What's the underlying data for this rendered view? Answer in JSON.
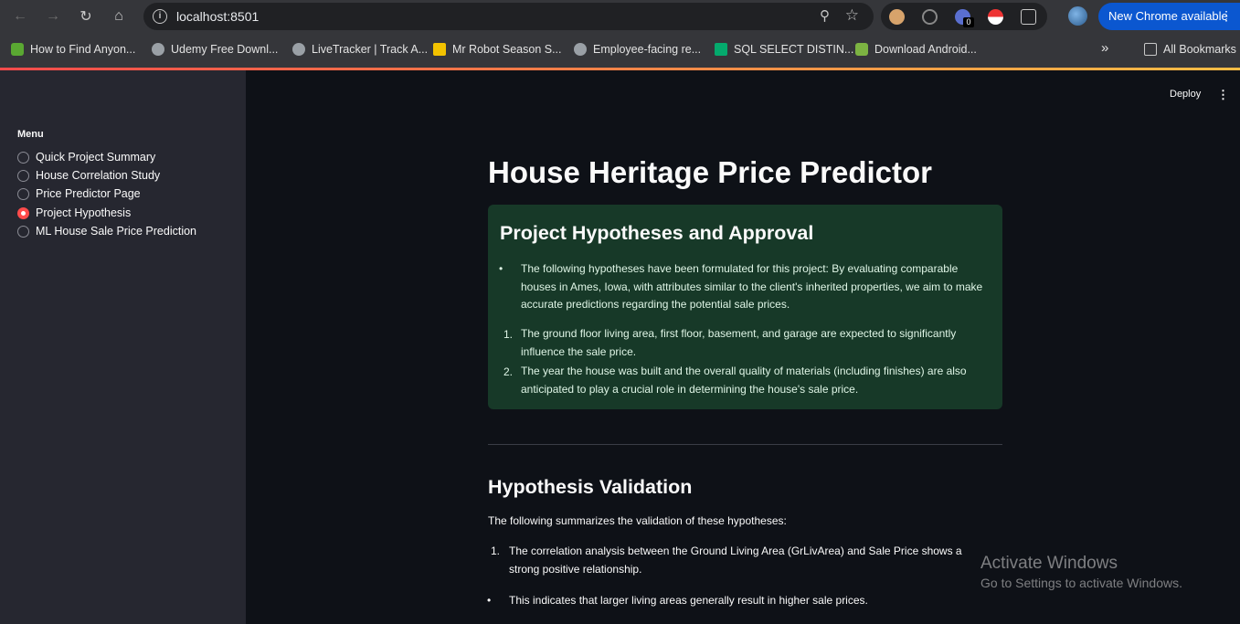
{
  "browser": {
    "url": "localhost:8501",
    "update_button": "New Chrome available",
    "extension_badge": "0",
    "bookmarks": [
      "How to Find Anyon...",
      "Udemy Free Downl...",
      "LiveTracker | Track A...",
      "Mr Robot Season S...",
      "Employee-facing re...",
      "SQL SELECT DISTIN...",
      "Download Android..."
    ],
    "bookmarks_overflow": "»",
    "all_bookmarks": "All Bookmarks"
  },
  "sidebar": {
    "menu_label": "Menu",
    "items": [
      {
        "label": "Quick Project Summary",
        "selected": false
      },
      {
        "label": "House Correlation Study",
        "selected": false
      },
      {
        "label": "Price Predictor Page",
        "selected": false
      },
      {
        "label": "Project Hypothesis",
        "selected": true
      },
      {
        "label": "ML House Sale Price Prediction",
        "selected": false
      }
    ]
  },
  "header": {
    "deploy_label": "Deploy"
  },
  "main": {
    "title": "House Heritage Price Predictor",
    "success_box": {
      "heading": "Project Hypotheses and Approval",
      "bullet": "The following hypotheses have been formulated for this project: By evaluating comparable houses in Ames, Iowa, with attributes similar to the client's inherited properties, we aim to make accurate predictions regarding the potential sale prices.",
      "numbered": [
        "The ground floor living area, first floor, basement, and garage are expected to significantly influence the sale price.",
        "The year the house was built and the overall quality of materials (including finishes) are also anticipated to play a crucial role in determining the house's sale price."
      ]
    },
    "validation_heading": "Hypothesis Validation",
    "validation_intro": "The following summarizes the validation of these hypotheses:",
    "validation_item_1": "The correlation analysis between the Ground Living Area (GrLivArea) and Sale Price shows a strong positive relationship.",
    "validation_bullet": "This indicates that larger living areas generally result in higher sale prices."
  },
  "watermark": {
    "line1": "Activate Windows",
    "line2": "Go to Settings to activate Windows."
  },
  "colors": {
    "accent": "#ff4b4b",
    "success_bg": "#173928",
    "sidebar_bg": "#262730",
    "main_bg": "#0e1117"
  }
}
